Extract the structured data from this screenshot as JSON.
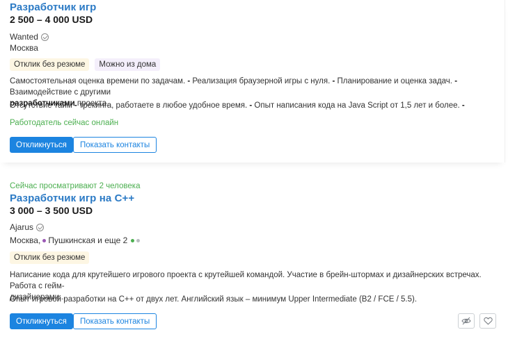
{
  "colors": {
    "accent": "#1c84e0",
    "title": "#2b7ac5",
    "online": "#4caf50"
  },
  "vacancies": [
    {
      "title": "Разработчик игр",
      "salary": "2 500 – 4 000 USD",
      "company": "Wanted",
      "location": "Москва",
      "tags": [
        "Отклик без резюме",
        "Можно из дома"
      ],
      "desc1_parts": [
        "Самостоятельная оценка времени по задачам. ",
        "- ",
        "Реализация браузерной игры с нуля. ",
        "- ",
        "Планирование и оценка задач. ",
        "- ",
        "Взаимодействие с другими"
      ],
      "desc1_line2_bold": "разработчиками",
      "desc1_line2_rest": " проекта.",
      "desc2_parts": [
        "Отсутствие тайм ",
        "- ",
        "трекинга, работаете в любое удобное время. ",
        "- ",
        "Опыт написания кода на Java Script от 1,5 лет и более. ",
        "-"
      ],
      "online": "Работодатель сейчас онлайн",
      "respond_label": "Откликнуться",
      "contacts_label": "Показать контакты"
    },
    {
      "viewing": "Сейчас просматривают 2 человека",
      "title": "Разработчик игр на C++",
      "salary": "3 000 – 3 500 USD",
      "company": "Ajarus",
      "location_city": "Москва,",
      "location_metro": "Пушкинская и еще 2",
      "metro_colors": [
        "#9a58b4",
        "#4caf50",
        "#b8bcc0"
      ],
      "tags": [
        "Отклик без резюме"
      ],
      "desc1_line1": "Написание кода для крутейшего игрового проекта с крутейшей командой. Участие в брейн-штормах и дизайнерских встречах. Работа с гейм-",
      "desc1_line2": "дизайнерами...",
      "desc2": "Опыт игровой разработки на C++ от двух лет. Английский язык – минимум Upper Intermediate (B2 / FCE / 5.5).",
      "respond_label": "Откликнуться",
      "contacts_label": "Показать контакты",
      "hide_icon": "eye-off-icon",
      "favorite_icon": "heart-icon"
    }
  ]
}
